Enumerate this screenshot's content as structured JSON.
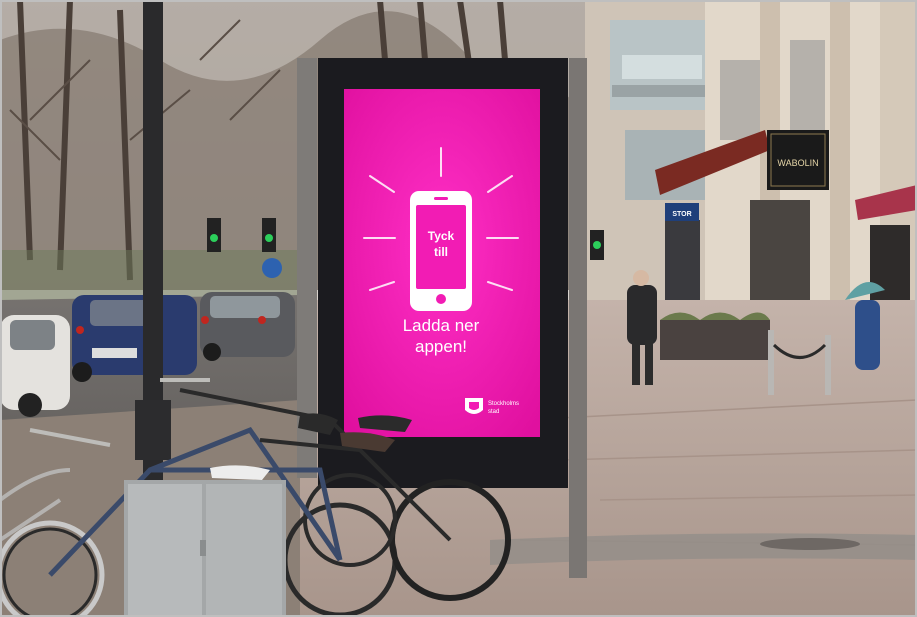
{
  "photo": {
    "colors": {
      "screen_magenta": "#f21cb4",
      "screen_magenta_dark": "#d0129a",
      "frame": "#1b1b1f",
      "pavement": "#b9a79e",
      "sky": "#d9d4cf",
      "storefront": "#d8cdbf",
      "shop_sign": "#1a1a1a"
    },
    "billboard": {
      "phone_label_line1": "Tyck",
      "phone_label_line2": "till",
      "message_line1": "Ladda ner",
      "message_line2": "appen!",
      "logo_text_line1": "Stockholms",
      "logo_text_line2": "stad"
    },
    "storefront_signs": {
      "shop_sign": "WABOLIN",
      "shop_sign_sub": "",
      "blue_sign": "STOR"
    }
  }
}
